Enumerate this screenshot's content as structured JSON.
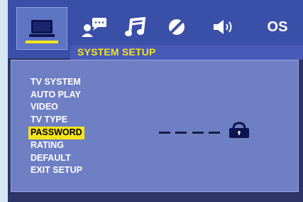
{
  "header": {
    "tabs": [
      {
        "name": "system",
        "icon": "monitor-icon",
        "selected": true
      },
      {
        "name": "language",
        "icon": "person-speech-icon",
        "selected": false
      },
      {
        "name": "audio",
        "icon": "music-note-icon",
        "selected": false
      },
      {
        "name": "video",
        "icon": "disc-icon",
        "selected": false
      },
      {
        "name": "speaker",
        "icon": "speaker-icon",
        "selected": false
      },
      {
        "name": "os",
        "label": "OS",
        "selected": false
      }
    ]
  },
  "title": "SYSTEM SETUP",
  "menu": {
    "items": [
      "TV SYSTEM",
      "AUTO PLAY",
      "VIDEO",
      "TV TYPE",
      "PASSWORD",
      "RATING",
      "DEFAULT",
      "EXIT SETUP"
    ],
    "selected_index": 4
  },
  "password": {
    "icon": "lock-icon"
  },
  "colors": {
    "accent": "#f3e41b",
    "panel": "#6f7fc4",
    "header": "#3a4fa7"
  }
}
